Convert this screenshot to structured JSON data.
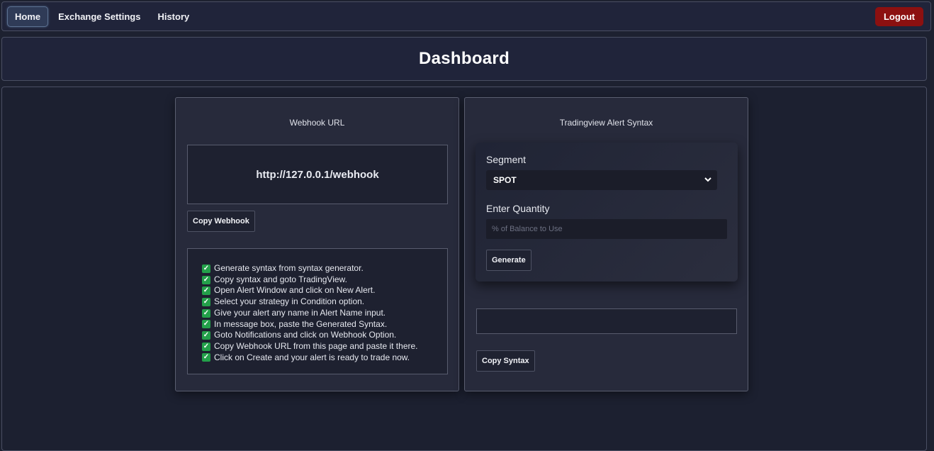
{
  "nav": {
    "home": "Home",
    "exchange_settings": "Exchange Settings",
    "history": "History",
    "logout": "Logout"
  },
  "page": {
    "title": "Dashboard"
  },
  "webhook_card": {
    "title": "Webhook URL",
    "url": "http://127.0.0.1/webhook",
    "copy_button": "Copy Webhook",
    "steps": [
      "Generate syntax from syntax generator.",
      "Copy syntax and goto TradingView.",
      "Open Alert Window and click on New Alert.",
      "Select your strategy in Condition option.",
      "Give your alert any name in Alert Name input.",
      "In message box, paste the Generated Syntax.",
      "Goto Notifications and click on Webhook Option.",
      "Copy Webhook URL from this page and paste it there.",
      "Click on Create and your alert is ready to trade now."
    ]
  },
  "syntax_card": {
    "title": "Tradingview Alert Syntax",
    "segment_label": "Segment",
    "segment_value": "SPOT",
    "quantity_label": "Enter Quantity",
    "quantity_placeholder": "% of Balance to Use",
    "quantity_value": "",
    "generate_button": "Generate",
    "syntax_output": "",
    "copy_button": "Copy Syntax"
  },
  "icons": {
    "step_check": "checkbox-checked-icon",
    "select_arrow": "chevron-down-icon"
  },
  "colors": {
    "logout_bg": "#8c1010",
    "check_green": "#23a04a",
    "background": "#1d2130",
    "card_bg": "#272a3b"
  }
}
